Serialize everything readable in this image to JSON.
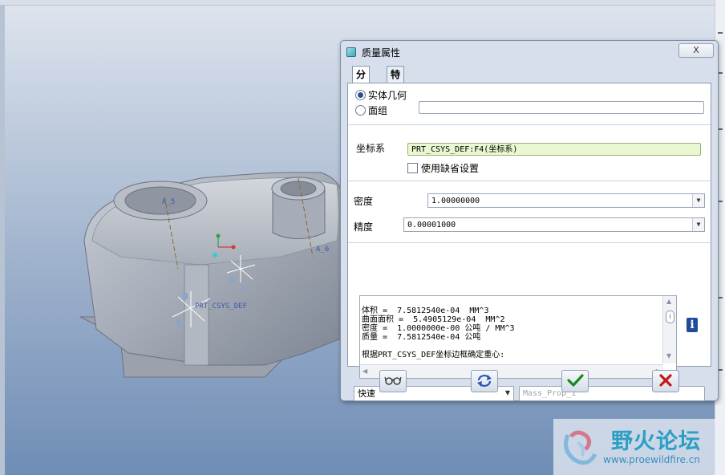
{
  "viewport": {
    "model_labels": {
      "a5": "A_5",
      "a6": "A_6",
      "csys": "PRT_CSYS_DEF"
    }
  },
  "dialog": {
    "title": "质量属性",
    "close_label": "X",
    "tabs": [
      {
        "label": "分析",
        "active": true
      },
      {
        "label": "特征",
        "active": false
      }
    ],
    "geometry": {
      "option_solid": "实体几何",
      "option_quilt": "面组",
      "selected": "实体几何",
      "quilt_value": ""
    },
    "csys": {
      "label": "坐标系",
      "value": "PRT_CSYS_DEF:F4(坐标系)",
      "use_default_label": "使用缺省设置",
      "use_default_checked": false
    },
    "density": {
      "label": "密度",
      "value": "1.00000000"
    },
    "accuracy": {
      "label": "精度",
      "value": "0.00001000"
    },
    "results": {
      "lines": [
        "体积 =  7.5812540e-04  MM^3",
        "曲面面积 =  5.4905129e-04  MM^2",
        "密度 =  1.0000000e-00 公吨 / MM^3",
        "质量 =  7.5812540e-04 公吨",
        "",
        "根据PRT_CSYS_DEF坐标边框确定重心:"
      ]
    },
    "mode": {
      "value": "快速",
      "options": [
        "快速"
      ]
    },
    "feature_name_placeholder": "Mass_Prop_1",
    "buttons": {
      "preview": "glasses-icon",
      "repeat": "refresh-icon",
      "ok": "check-icon",
      "cancel": "cancel-x-icon"
    },
    "colors": {
      "ok_green": "#1a8a1a",
      "cancel_red": "#c21a1a",
      "csys_field_bg": "#e9f8d0"
    }
  },
  "watermark": {
    "name": "野火论坛",
    "url": "www.proewildfire.cn"
  }
}
